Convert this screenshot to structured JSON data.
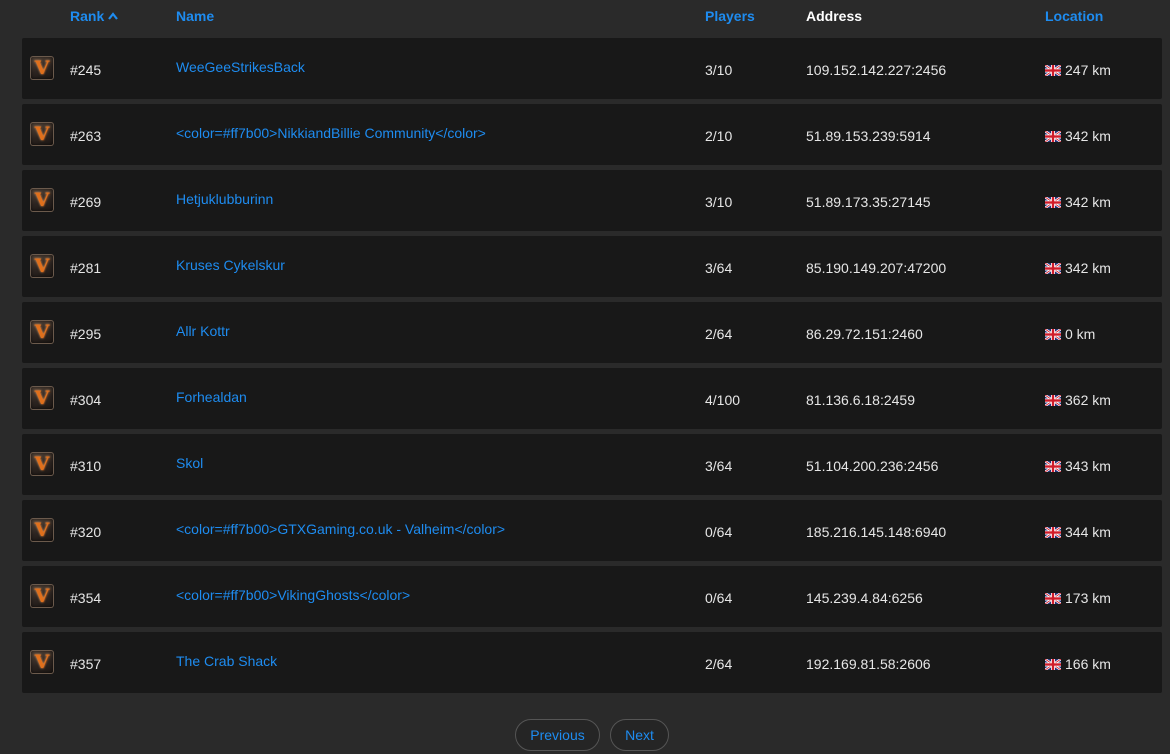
{
  "columns": {
    "rank": "Rank",
    "name": "Name",
    "players": "Players",
    "address": "Address",
    "location": "Location"
  },
  "sort": {
    "column": "rank",
    "direction": "ascending",
    "icon": "chevron-up-icon"
  },
  "colors": {
    "link": "#1e8cf0",
    "row_bg": "#181818",
    "page_bg": "#2a2a2a"
  },
  "servers": [
    {
      "icon": "valheim-icon",
      "rank": "#245",
      "name": "WeeGeeStrikesBack",
      "players": "3/10",
      "address": "109.152.142.227:2456",
      "flag": "uk-flag-icon",
      "distance": "247 km"
    },
    {
      "icon": "valheim-icon",
      "rank": "#263",
      "name": "<color=#ff7b00>NikkiandBillie Community</color>",
      "players": "2/10",
      "address": "51.89.153.239:5914",
      "flag": "uk-flag-icon",
      "distance": "342 km"
    },
    {
      "icon": "valheim-icon",
      "rank": "#269",
      "name": "Hetjuklubburinn",
      "players": "3/10",
      "address": "51.89.173.35:27145",
      "flag": "uk-flag-icon",
      "distance": "342 km"
    },
    {
      "icon": "valheim-icon",
      "rank": "#281",
      "name": "Kruses Cykelskur",
      "players": "3/64",
      "address": "85.190.149.207:47200",
      "flag": "uk-flag-icon",
      "distance": "342 km"
    },
    {
      "icon": "valheim-icon",
      "rank": "#295",
      "name": "Allr Kottr",
      "players": "2/64",
      "address": "86.29.72.151:2460",
      "flag": "uk-flag-icon",
      "distance": "0 km"
    },
    {
      "icon": "valheim-icon",
      "rank": "#304",
      "name": "Forhealdan",
      "players": "4/100",
      "address": "81.136.6.18:2459",
      "flag": "uk-flag-icon",
      "distance": "362 km"
    },
    {
      "icon": "valheim-icon",
      "rank": "#310",
      "name": "Skol",
      "players": "3/64",
      "address": "51.104.200.236:2456",
      "flag": "uk-flag-icon",
      "distance": "343 km"
    },
    {
      "icon": "valheim-icon",
      "rank": "#320",
      "name": "<color=#ff7b00>GTXGaming.co.uk - Valheim</color>",
      "players": "0/64",
      "address": "185.216.145.148:6940",
      "flag": "uk-flag-icon",
      "distance": "344 km"
    },
    {
      "icon": "valheim-icon",
      "rank": "#354",
      "name": "<color=#ff7b00>VikingGhosts</color>",
      "players": "0/64",
      "address": "145.239.4.84:6256",
      "flag": "uk-flag-icon",
      "distance": "173 km"
    },
    {
      "icon": "valheim-icon",
      "rank": "#357",
      "name": "The Crab Shack",
      "players": "2/64",
      "address": "192.169.81.58:2606",
      "flag": "uk-flag-icon",
      "distance": "166 km"
    }
  ],
  "pagination": {
    "previous": "Previous",
    "next": "Next"
  }
}
